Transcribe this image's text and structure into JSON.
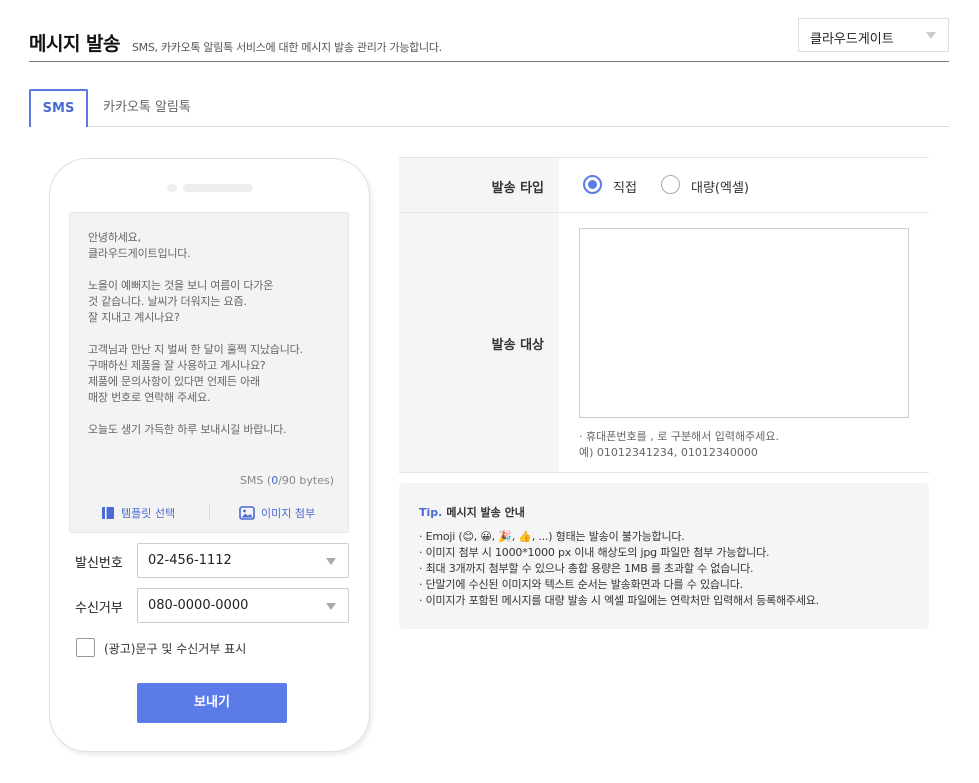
{
  "header": {
    "title": "메시지 발송",
    "description": "SMS, 카카오톡 알림톡 서비스에 대한 메시지 발송 관리가 가능합니다.",
    "gateway_value": "클라우드게이트"
  },
  "tabs": [
    {
      "label": "SMS",
      "active": true
    },
    {
      "label": "카카오톡 알림톡",
      "active": false
    }
  ],
  "preview": {
    "message": "안녕하세요,\n클라우드게이트입니다.\n\n노을이 예뻐지는 것을 보니 여름이 다가온\n것 같습니다. 날씨가 더워지는 요즘.\n잘 지내고 계시나요?\n\n고객님과 만난 지 벌써 한 달이 훌쩍 지났습니다.\n구매하신 제품을 잘 사용하고 계시나요?\n제품에 문의사항이 있다면 언제든 아래\n매장 번호로 연락해 주세요.\n\n오늘도 생기 가득한 하루 보내시길 바랍니다.",
    "byte_prefix": "SMS (",
    "byte_count": "0",
    "byte_suffix": "/90 bytes)",
    "template_label": "템플릿 선택",
    "image_label": "이미지 첨부"
  },
  "sender": {
    "label": "발신번호",
    "value": "02-456-1112"
  },
  "reject": {
    "label": "수신거부",
    "value": "080-0000-0000"
  },
  "ad_checkbox": {
    "label": "(광고)문구 및 수신거부 표시",
    "checked": false
  },
  "send_button": "보내기",
  "form": {
    "send_type_label": "발송 타입",
    "options": [
      "직접",
      "대량(엑셀)"
    ],
    "selected": "직접",
    "target_label": "발송 대상",
    "target_value": "",
    "hint": "· 휴대폰번호를 , 로 구분해서 입력해주세요.\n예) 01012341234, 01012340000"
  },
  "tip": {
    "prefix": "Tip.",
    "title": "메시지 발송 안내",
    "items": [
      "· Emoji (😊, 😀, 🎉, 👍, ...) 형태는 발송이 불가능합니다.",
      "· 이미지 첨부 시 1000*1000 px 이내 해상도의 jpg 파일만 첨부 가능합니다.",
      "· 최대 3개까지 첨부할 수 있으나 총합 용량은 1MB 를 초과할 수 없습니다.",
      "· 단말기에 수신된 이미지와 텍스트 순서는 발송화면과 다를 수 있습니다.",
      "· 이미지가 포함된 메시지를 대량 발송 시 엑셀 파일에는 연락처만 입력해서 등록해주세요."
    ]
  },
  "colors": {
    "accent": "#5b7be8",
    "link": "#4a6ad6"
  }
}
